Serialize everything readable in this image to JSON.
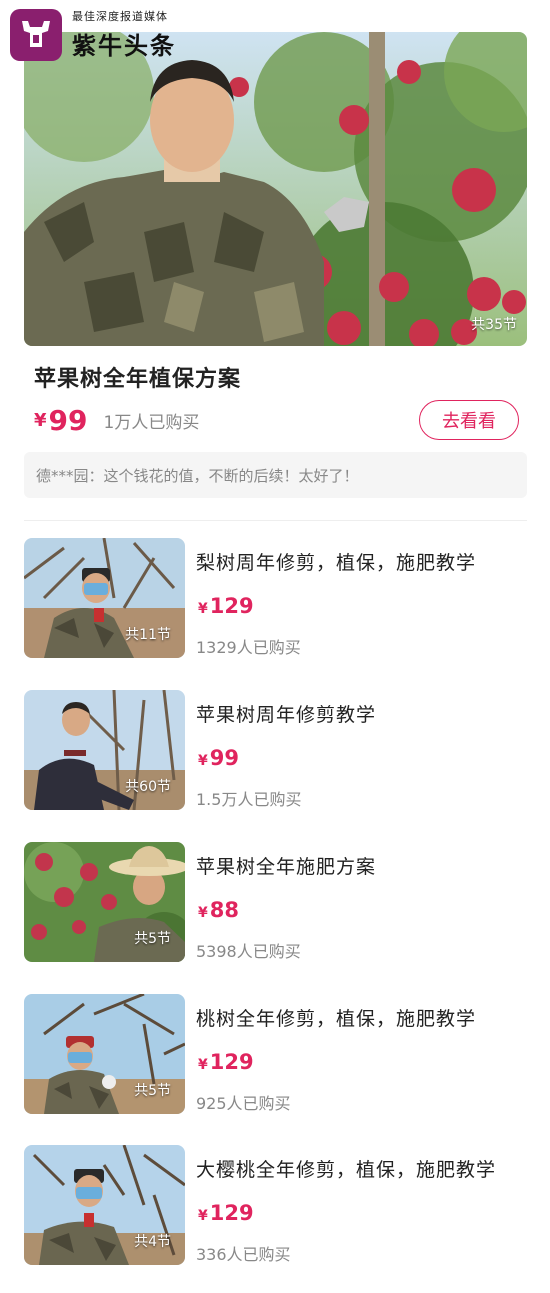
{
  "watermark": {
    "slogan": "最佳深度报道媒体",
    "name": "紫牛头条"
  },
  "featured": {
    "lessons": "共35节",
    "title": "苹果树全年植保方案",
    "currency": "¥",
    "price": "99",
    "buyers": "1万人已购买",
    "button": "去看看",
    "review": "德***园：这个钱花的值，不断的后续！太好了！"
  },
  "courses": [
    {
      "title": "梨树周年修剪，植保，施肥教学",
      "currency": "¥",
      "price": "129",
      "buyers": "1329人已购买",
      "lessons": "共11节"
    },
    {
      "title": "苹果树周年修剪教学",
      "currency": "¥",
      "price": "99",
      "buyers": "1.5万人已购买",
      "lessons": "共60节"
    },
    {
      "title": "苹果树全年施肥方案",
      "currency": "¥",
      "price": "88",
      "buyers": "5398人已购买",
      "lessons": "共5节"
    },
    {
      "title": "桃树全年修剪，植保，施肥教学",
      "currency": "¥",
      "price": "129",
      "buyers": "925人已购买",
      "lessons": "共5节"
    },
    {
      "title": "大樱桃全年修剪，植保，施肥教学",
      "currency": "¥",
      "price": "129",
      "buyers": "336人已购买",
      "lessons": "共4节"
    }
  ],
  "colors": {
    "accent": "#e0245e",
    "logo": "#8a1f6e",
    "muted": "#888888"
  }
}
